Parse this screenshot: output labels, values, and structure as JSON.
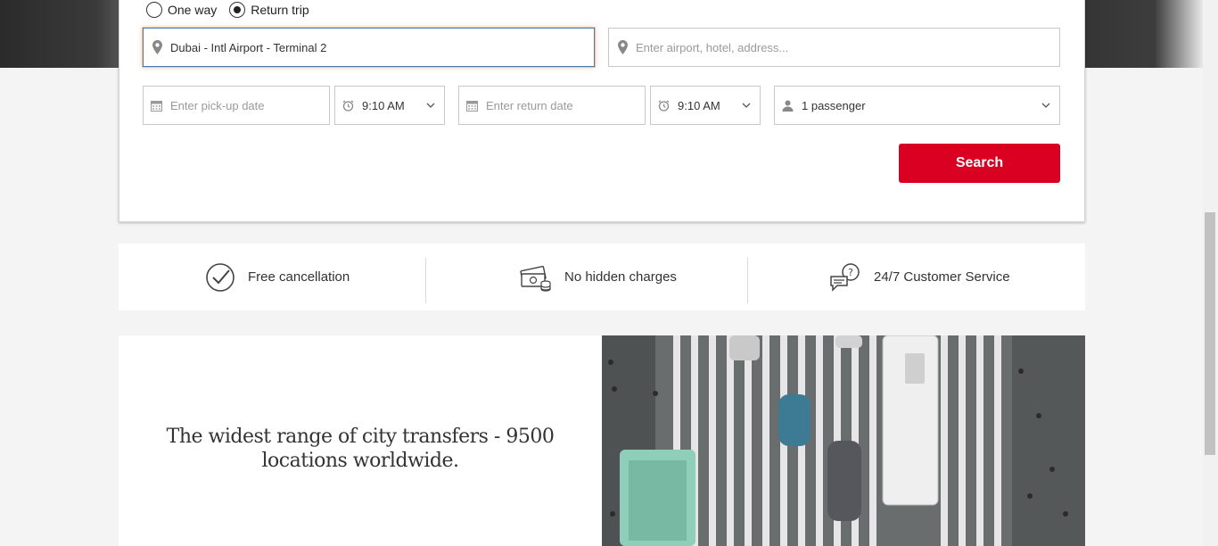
{
  "trip_type": {
    "options": [
      {
        "label": "One way",
        "selected": false
      },
      {
        "label": "Return trip",
        "selected": true
      }
    ]
  },
  "pickup": {
    "value": "Dubai - Intl Airport - Terminal 2",
    "icon": "location-pin-icon"
  },
  "dropoff": {
    "placeholder": "Enter airport, hotel, address...",
    "icon": "location-pin-icon"
  },
  "pickup_date": {
    "placeholder": "Enter pick-up date",
    "icon": "calendar-icon"
  },
  "pickup_time": {
    "value": "9:10 AM",
    "icon": "alarm-clock-icon"
  },
  "return_date": {
    "placeholder": "Enter return date",
    "icon": "calendar-icon"
  },
  "return_time": {
    "value": "9:10 AM",
    "icon": "alarm-clock-icon"
  },
  "passengers": {
    "value": "1 passenger",
    "icon": "person-icon"
  },
  "search_button": {
    "label": "Search",
    "color": "#d90022"
  },
  "features": [
    {
      "label": "Free cancellation",
      "icon": "checkmark-circle-icon"
    },
    {
      "label": "No hidden charges",
      "icon": "money-icon"
    },
    {
      "label": "24/7 Customer Service",
      "icon": "chat-question-icon"
    }
  ],
  "promo": {
    "headline": "The widest range of city transfers - 9500 locations worldwide."
  },
  "colors": {
    "accent": "#d90022",
    "focus_border": "#4a78b5",
    "background": "#f4f4f4"
  }
}
